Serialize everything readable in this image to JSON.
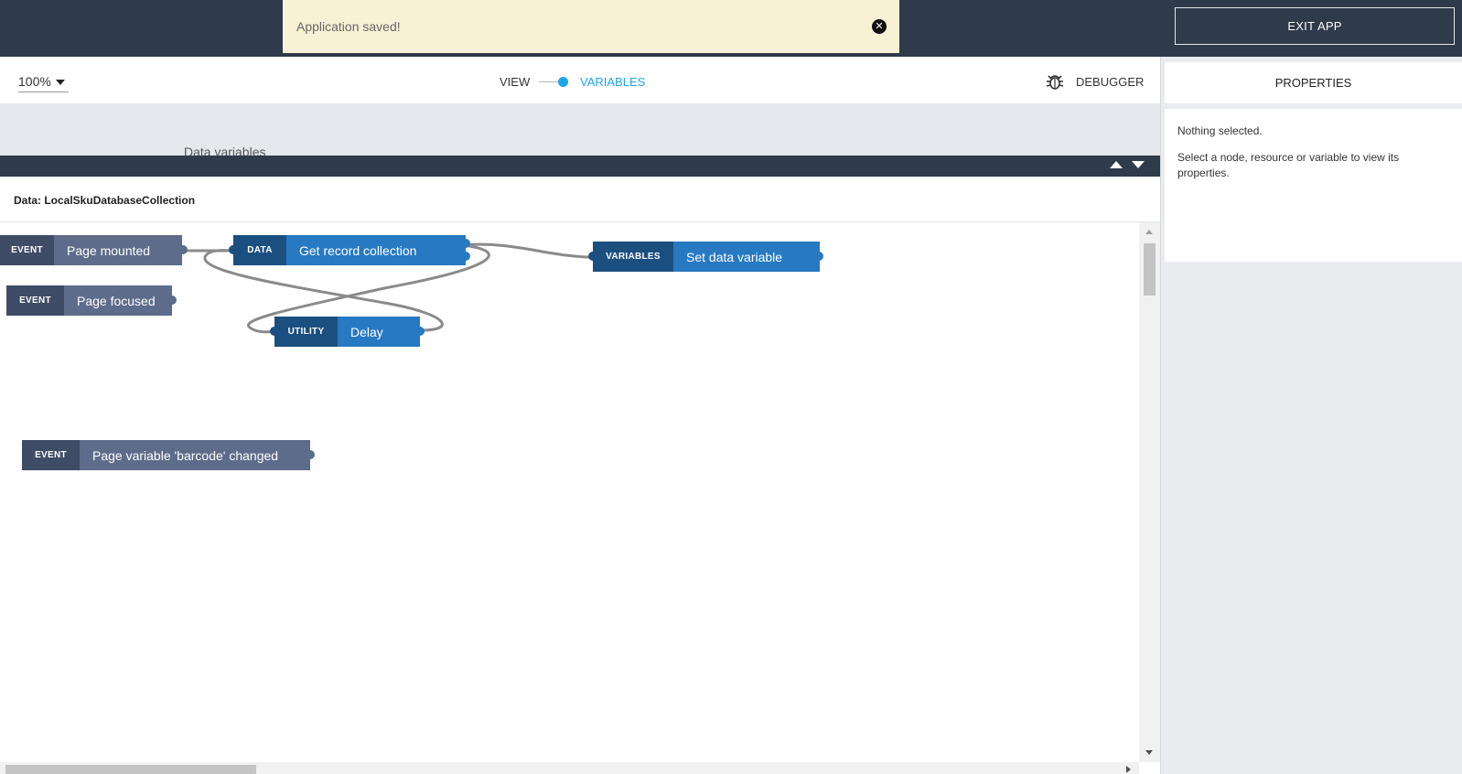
{
  "toast": {
    "message": "Application saved!",
    "close_icon": "close-circle-icon"
  },
  "header": {
    "exit_label": "EXIT APP"
  },
  "toolbar": {
    "zoom": "100%",
    "view_label": "VIEW",
    "variables_label": "VARIABLES",
    "debugger_label": "DEBUGGER",
    "debugger_icon": "bug-icon",
    "accent_color": "#1ea5e8"
  },
  "band": {
    "label": "Data variables"
  },
  "subheader": {
    "title": "Data: LocalSkuDatabaseCollection"
  },
  "nodes": [
    {
      "tag": "EVENT",
      "label": "Page mounted",
      "kind": "event"
    },
    {
      "tag": "DATA",
      "label": "Get record collection",
      "kind": "data"
    },
    {
      "tag": "VARIABLES",
      "label": "Set data variable",
      "kind": "variables"
    },
    {
      "tag": "EVENT",
      "label": "Page focused",
      "kind": "event"
    },
    {
      "tag": "UTILITY",
      "label": "Delay",
      "kind": "utility"
    },
    {
      "tag": "EVENT",
      "label": "Page variable 'barcode' changed",
      "kind": "event"
    }
  ],
  "properties": {
    "title": "PROPERTIES",
    "empty_title": "Nothing selected.",
    "empty_hint": "Select a node, resource or variable to view its properties."
  }
}
